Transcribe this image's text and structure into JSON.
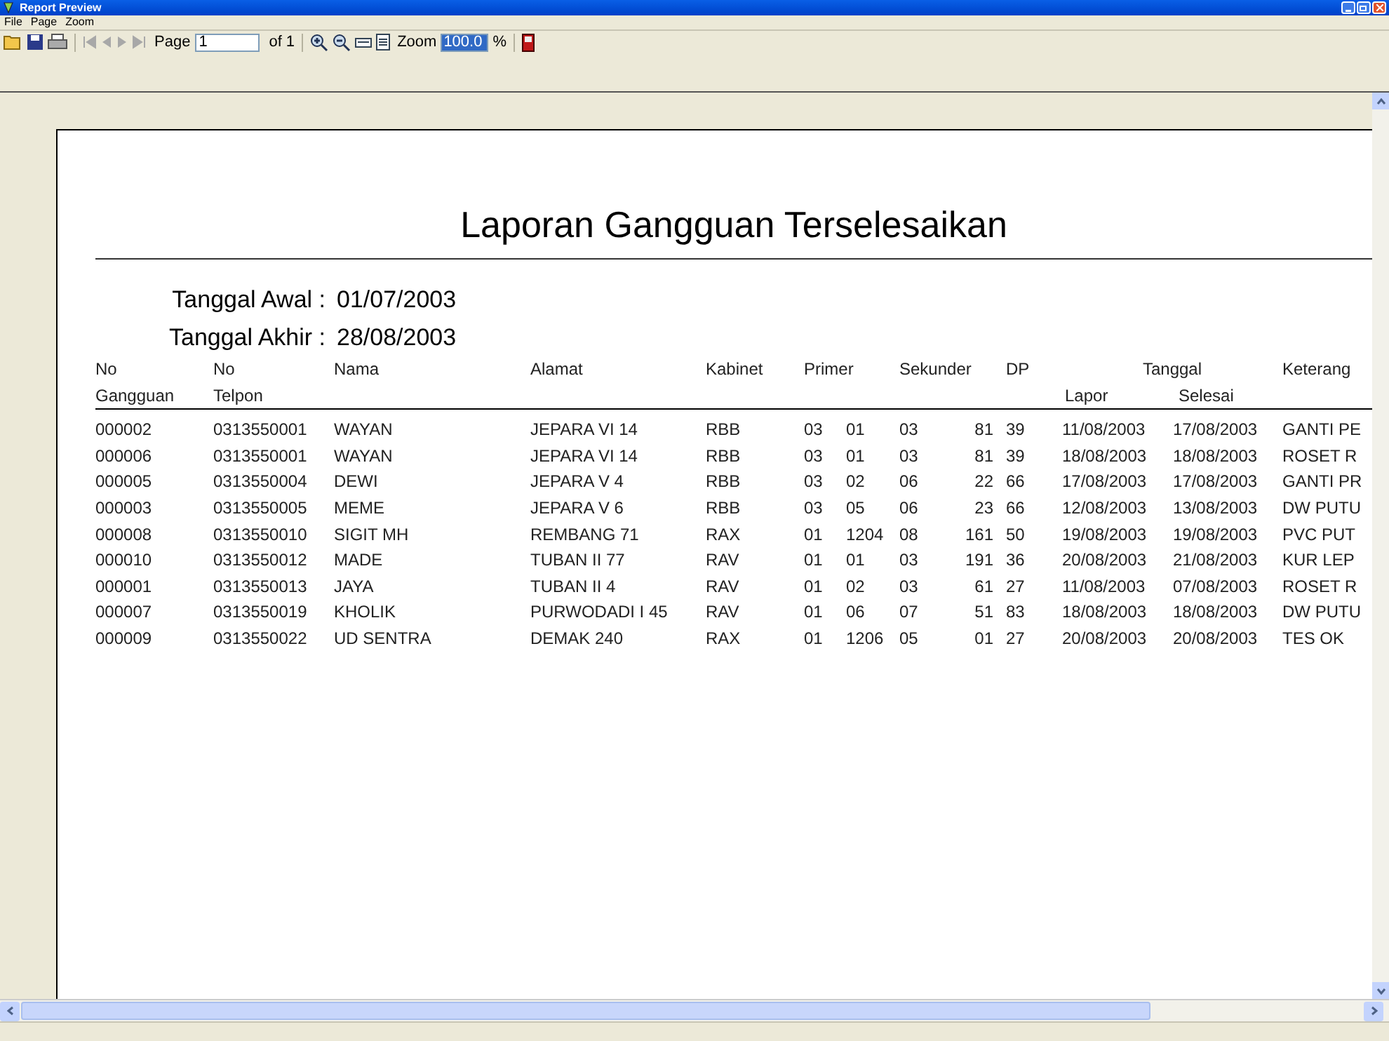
{
  "window": {
    "title": "Report Preview"
  },
  "menu": [
    "File",
    "Page",
    "Zoom"
  ],
  "toolbar": {
    "page_label": "Page",
    "page_value": "1",
    "page_of": "of 1",
    "zoom_label": "Zoom",
    "zoom_value": "100.0",
    "zoom_unit": "%"
  },
  "report": {
    "title": "Laporan Gangguan Terselesaikan",
    "filters": [
      {
        "label": "Tanggal Awal :",
        "value": "01/07/2003"
      },
      {
        "label": "Tanggal Akhir :",
        "value": "28/08/2003"
      }
    ],
    "columns": [
      {
        "kind": "single",
        "lines": [
          "No",
          "Gangguan"
        ]
      },
      {
        "kind": "single",
        "lines": [
          "No",
          "Telpon"
        ]
      },
      {
        "kind": "single",
        "lines": [
          "Nama"
        ]
      },
      {
        "kind": "single",
        "lines": [
          "Alamat"
        ]
      },
      {
        "kind": "single",
        "lines": [
          "Kabinet"
        ]
      },
      {
        "kind": "double",
        "lines": [
          "Primer"
        ]
      },
      {
        "kind": "double",
        "lines": [
          "Sekunder"
        ]
      },
      {
        "kind": "single",
        "lines": [
          "DP"
        ]
      },
      {
        "kind": "group",
        "lines": [
          "Tanggal"
        ],
        "sub": [
          "Lapor",
          "Selesai"
        ]
      },
      {
        "kind": "single",
        "lines": [
          "Keterang"
        ]
      }
    ],
    "rows": [
      [
        "000002",
        "0313550001",
        "WAYAN",
        "JEPARA VI 14",
        "RBB",
        [
          "03",
          "01"
        ],
        [
          "03",
          "81"
        ],
        "39",
        [
          "11/08/2003",
          "17/08/2003"
        ],
        "GANTI PE"
      ],
      [
        "000006",
        "0313550001",
        "WAYAN",
        "JEPARA VI 14",
        "RBB",
        [
          "03",
          "01"
        ],
        [
          "03",
          "81"
        ],
        "39",
        [
          "18/08/2003",
          "18/08/2003"
        ],
        "ROSET R"
      ],
      [
        "000005",
        "0313550004",
        "DEWI",
        "JEPARA V 4",
        "RBB",
        [
          "03",
          "02"
        ],
        [
          "06",
          "22"
        ],
        "66",
        [
          "17/08/2003",
          "17/08/2003"
        ],
        "GANTI PR"
      ],
      [
        "000003",
        "0313550005",
        "MEME",
        "JEPARA V 6",
        "RBB",
        [
          "03",
          "05"
        ],
        [
          "06",
          "23"
        ],
        "66",
        [
          "12/08/2003",
          "13/08/2003"
        ],
        "DW PUTU"
      ],
      [
        "000008",
        "0313550010",
        "SIGIT MH",
        "REMBANG 71",
        "RAX",
        [
          "01",
          "1204"
        ],
        [
          "08",
          "161"
        ],
        "50",
        [
          "19/08/2003",
          "19/08/2003"
        ],
        "PVC PUT"
      ],
      [
        "000010",
        "0313550012",
        "MADE",
        "TUBAN II 77",
        "RAV",
        [
          "01",
          "01"
        ],
        [
          "03",
          "191"
        ],
        "36",
        [
          "20/08/2003",
          "21/08/2003"
        ],
        "KUR LEP"
      ],
      [
        "000001",
        "0313550013",
        "JAYA",
        "TUBAN II 4",
        "RAV",
        [
          "01",
          "02"
        ],
        [
          "03",
          "61"
        ],
        "27",
        [
          "11/08/2003",
          "07/08/2003"
        ],
        "ROSET R"
      ],
      [
        "000007",
        "0313550019",
        "KHOLIK",
        "PURWODADI I 45",
        "RAV",
        [
          "01",
          "06"
        ],
        [
          "07",
          "51"
        ],
        "83",
        [
          "18/08/2003",
          "18/08/2003"
        ],
        "DW PUTU"
      ],
      [
        "000009",
        "0313550022",
        "UD SENTRA",
        "DEMAK 240",
        "RAX",
        [
          "01",
          "1206"
        ],
        [
          "05",
          "01"
        ],
        "27",
        [
          "20/08/2003",
          "20/08/2003"
        ],
        "TES OK"
      ]
    ]
  }
}
